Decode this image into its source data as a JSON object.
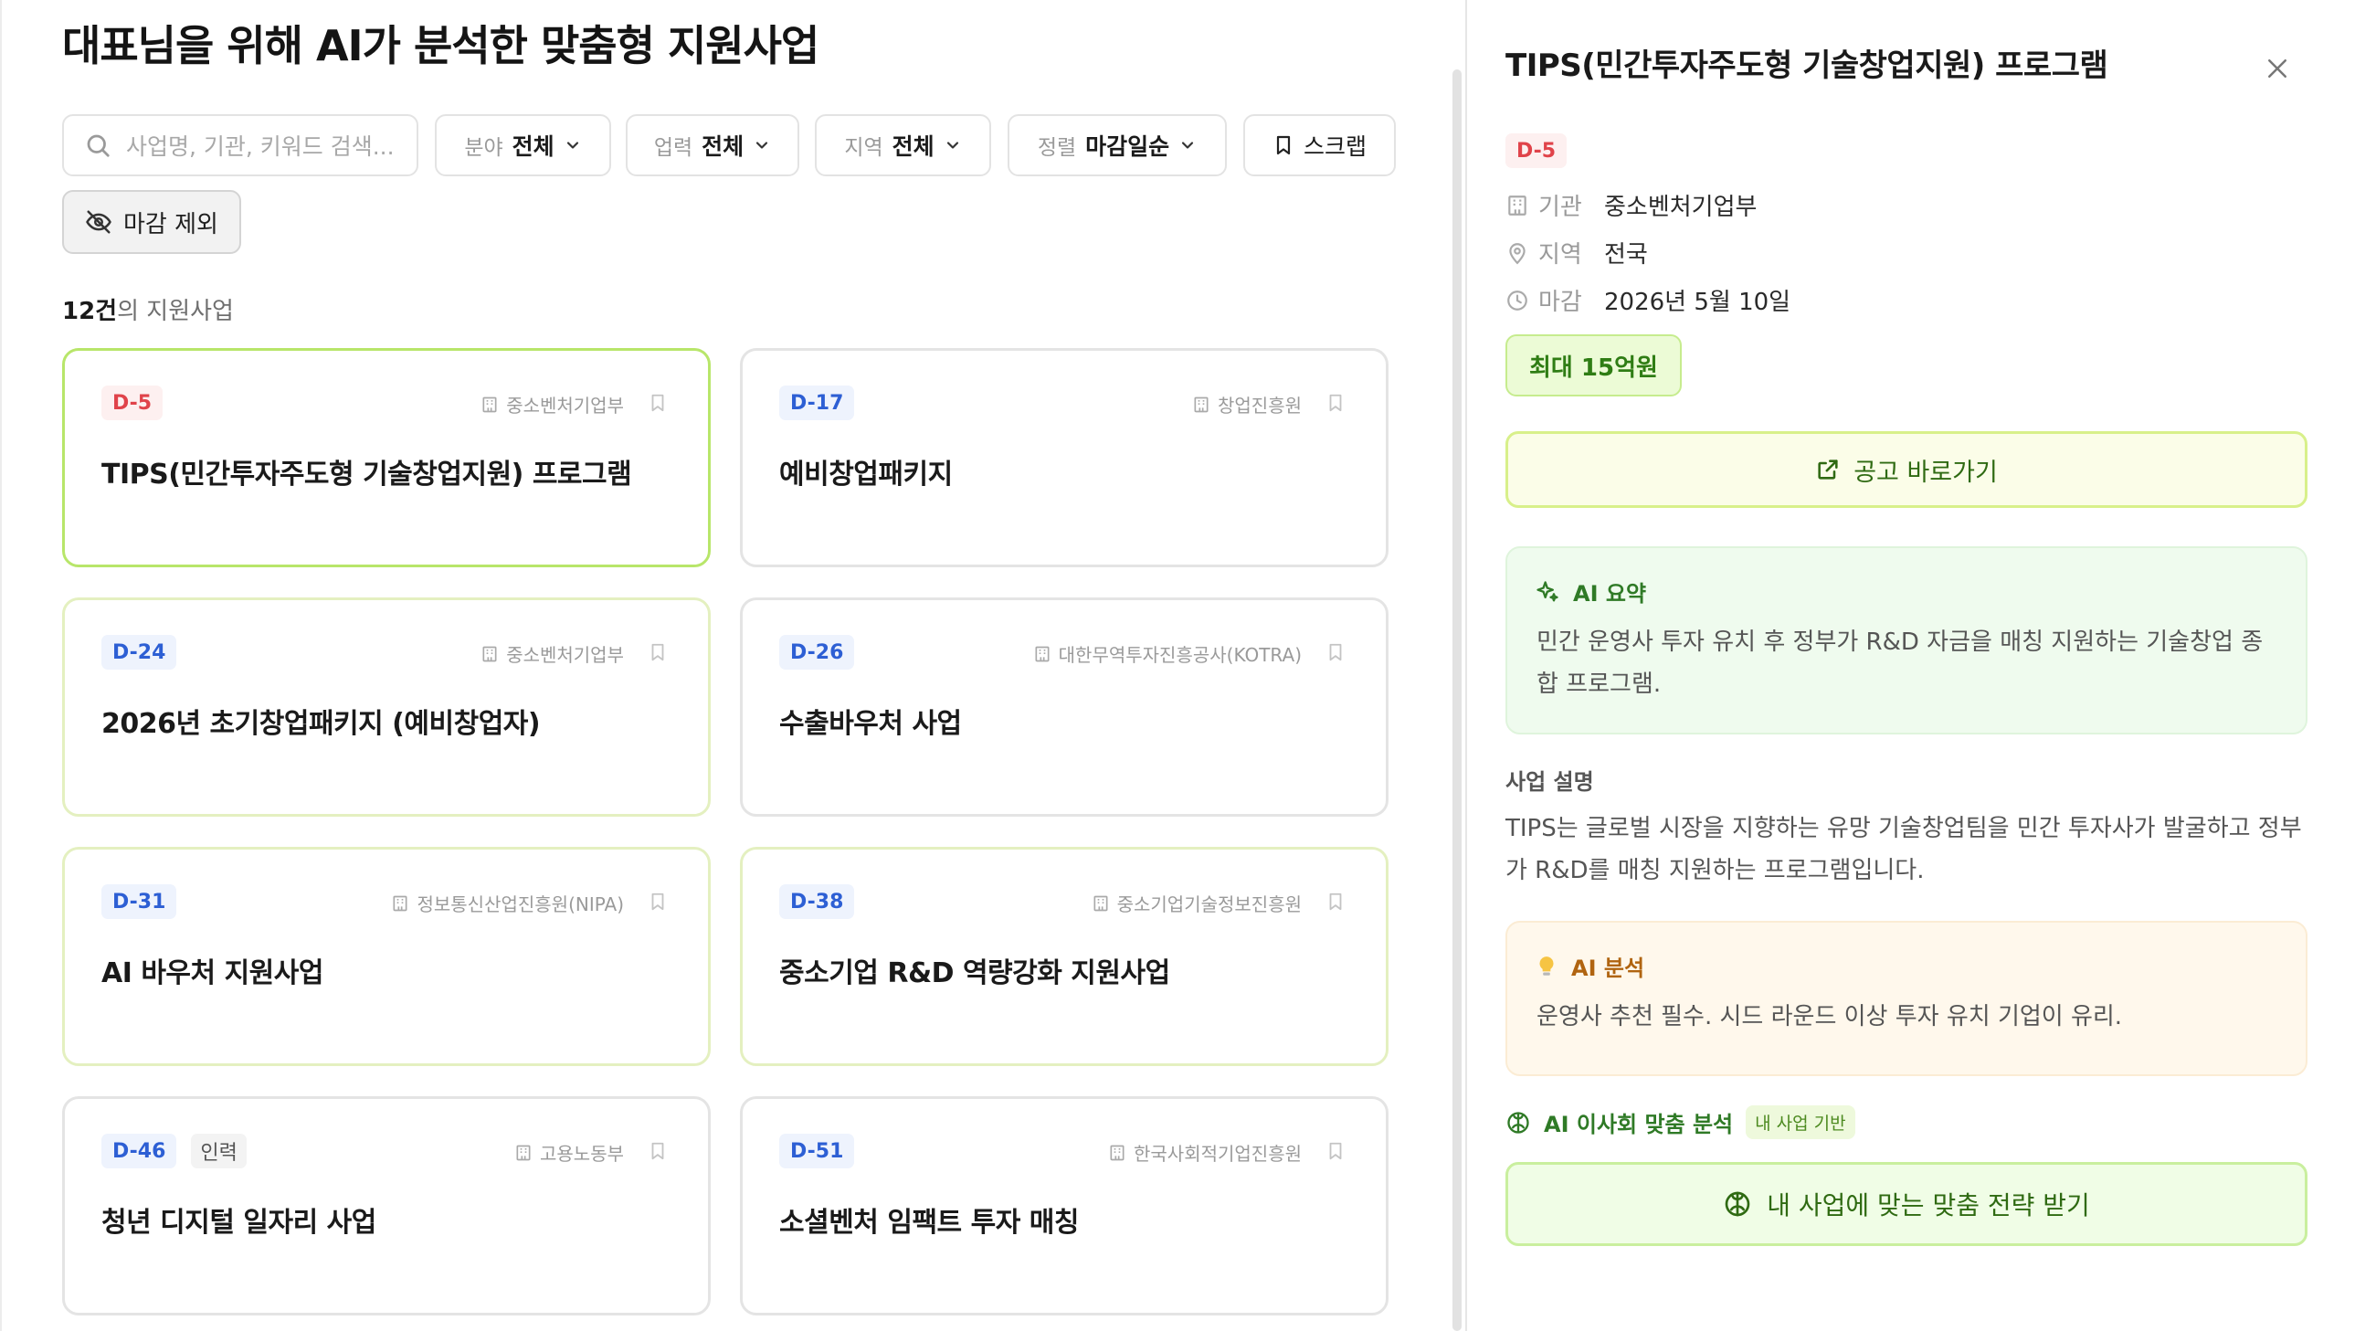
{
  "page_title": "대표님을 위해 AI가 분석한 맞춤형 지원사업",
  "search": {
    "placeholder": "사업명, 기관, 키워드 검색..."
  },
  "filters": {
    "field": {
      "label": "분야",
      "value": "전체"
    },
    "career": {
      "label": "업력",
      "value": "전체"
    },
    "region": {
      "label": "지역",
      "value": "전체"
    },
    "sort": {
      "label": "정렬",
      "value": "마감일순"
    },
    "scrap_label": "스크랩",
    "exclude_closed_label": "마감 제외"
  },
  "result_count": {
    "number": "12건",
    "suffix": "의 지원사업"
  },
  "cards": [
    {
      "dday": "D-5",
      "tag": "",
      "org": "중소벤처기업부",
      "title": "TIPS(민간투자주도형 기술창업지원) 프로그램",
      "selected": true
    },
    {
      "dday": "D-17",
      "tag": "",
      "org": "창업진흥원",
      "title": "예비창업패키지"
    },
    {
      "dday": "D-24",
      "tag": "",
      "org": "중소벤처기업부",
      "title": "2026년 초기창업패키지 (예비창업자)"
    },
    {
      "dday": "D-26",
      "tag": "",
      "org": "대한무역투자진흥공사(KOTRA)",
      "title": "수출바우처 사업"
    },
    {
      "dday": "D-31",
      "tag": "",
      "org": "정보통신산업진흥원(NIPA)",
      "title": "AI 바우처 지원사업"
    },
    {
      "dday": "D-38",
      "tag": "",
      "org": "중소기업기술정보진흥원",
      "title": "중소기업 R&D 역량강화 지원사업"
    },
    {
      "dday": "D-46",
      "tag": "인력",
      "org": "고용노동부",
      "title": "청년 디지털 일자리 사업"
    },
    {
      "dday": "D-51",
      "tag": "",
      "org": "한국사회적기업진흥원",
      "title": "소셜벤처 임팩트 투자 매칭"
    }
  ],
  "detail": {
    "title": "TIPS(민간투자주도형 기술창업지원) 프로그램",
    "dday": "D-5",
    "agency": {
      "label": "기관",
      "value": "중소벤처기업부"
    },
    "region": {
      "label": "지역",
      "value": "전국"
    },
    "deadline": {
      "label": "마감",
      "value": "2026년 5월 10일"
    },
    "amount": "최대 15억원",
    "goto_label": "공고 바로가기",
    "ai_summary": {
      "heading": "AI 요약",
      "text": "민간 운영사 투자 유치 후 정부가 R&D 자금을 매칭 지원하는 기술창업 종합 프로그램."
    },
    "description": {
      "heading": "사업 설명",
      "text": "TIPS는 글로벌 시장을 지향하는 유망 기술창업팀을 민간 투자사가 발굴하고 정부가 R&D를 매칭 지원하는 프로그램입니다."
    },
    "ai_analysis": {
      "heading": "AI 분석",
      "text": "운영사 추천 필수. 시드 라운드 이상 투자 유치 기업이 유리."
    },
    "board": {
      "heading": "AI 이사회 맞춤 분석",
      "badge": "내 사업 기반"
    },
    "strategy_label": "내 사업에 맞는 맞춤 전략 받기"
  },
  "colors": {
    "accent_green": "#2f7a26",
    "dday_blue": "#2d5fd4",
    "dday_red": "#e0434a",
    "selected_border": "#b8e66a"
  },
  "icons": [
    "search-icon",
    "chevron-down-icon",
    "bookmark-icon",
    "eye-off-icon",
    "building-icon",
    "close-icon",
    "map-pin-icon",
    "clock-icon",
    "external-link-icon",
    "sparkles-icon",
    "lightbulb-icon",
    "brain-icon"
  ]
}
